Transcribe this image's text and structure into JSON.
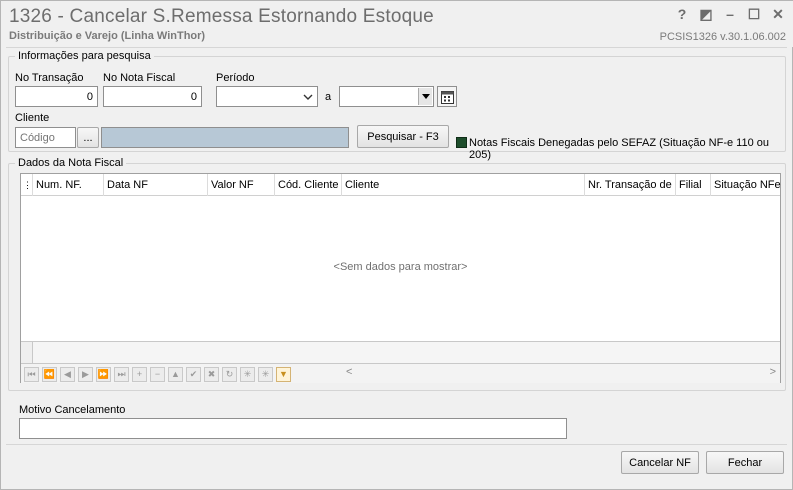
{
  "window": {
    "title": "1326 - Cancelar S.Remessa Estornando Estoque",
    "subtitle": "Distribuição e Varejo (Linha WinThor)",
    "version": "PCSIS1326  v.30.1.06.002",
    "controls": {
      "help": "?",
      "restore": "◩",
      "minimize": "–",
      "maximize": "☐",
      "close": "✕"
    }
  },
  "search": {
    "group_title": "Informações para pesquisa",
    "transacao_label": "No Transação",
    "transacao_value": "0",
    "nota_label": "No Nota Fiscal",
    "nota_value": "0",
    "periodo_label": "Período",
    "periodo_sep": "a",
    "periodo_start": "",
    "periodo_end": "",
    "cliente_label": "Cliente",
    "cliente_placeholder": "Código",
    "cliente_browse": "...",
    "pesquisar_button": "Pesquisar - F3",
    "denegadas_label": "Notas Fiscais Denegadas pelo SEFAZ (Situação NF-e 110 ou 205)"
  },
  "grid": {
    "group_title": "Dados da Nota Fiscal",
    "columns": [
      "Num. NF.",
      "Data NF",
      "Valor NF",
      "Cód. Cliente",
      "Cliente",
      "Nr. Transação de",
      "Filial",
      "Situação NFe"
    ],
    "empty_text": "<Sem dados para mostrar>",
    "nav": [
      "⏮",
      "⏪",
      "◀",
      "▶",
      "⏩",
      "⏭",
      "+",
      "−",
      "▲",
      "✔",
      "✖",
      "↻",
      "✳",
      "✳",
      "▼"
    ]
  },
  "motivo": {
    "label": "Motivo Cancelamento",
    "value": ""
  },
  "footer": {
    "cancelar_button": "Cancelar NF",
    "fechar_button": "Fechar"
  },
  "colors": {
    "title": "#6d6d6d",
    "client_desc": "#b7c8d6",
    "check": "#1d4d2b"
  }
}
